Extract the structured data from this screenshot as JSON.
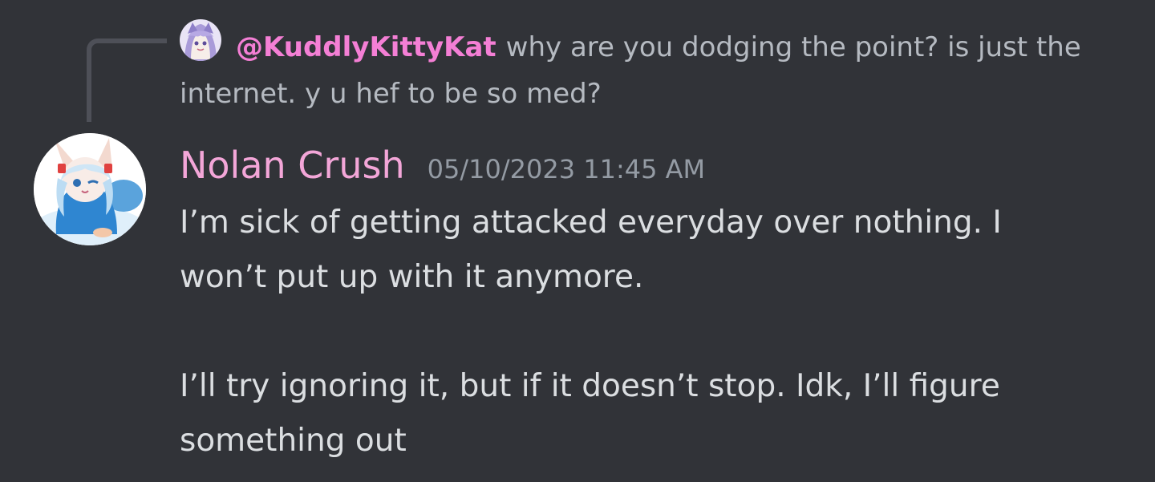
{
  "reply": {
    "mention": "@KuddlyKittyKat",
    "text": "why are you dodging the point? is just the internet. y u hef to be so med?"
  },
  "message": {
    "author": "Nolan Crush",
    "timestamp": "05/10/2023 11:45 AM",
    "paragraphs": [
      "I’m sick of getting attacked everyday over nothing. I won’t put up with it anymore.",
      "I’ll try ignoring it, but if it doesn’t stop. Idk, I’ll figure something out"
    ]
  },
  "colors": {
    "background": "#313338",
    "mention": "#f47fd5",
    "username": "#f3a6d8",
    "timestamp": "#949ba4",
    "reply_text": "#b5bac1",
    "message_text": "#dbdee1"
  }
}
